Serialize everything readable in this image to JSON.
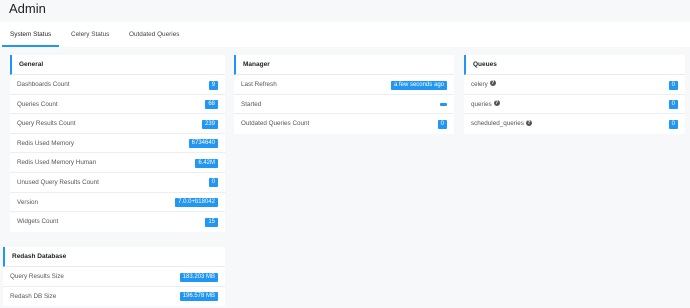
{
  "page": {
    "title": "Admin"
  },
  "tabs": [
    {
      "label": "System Status"
    },
    {
      "label": "Celery Status"
    },
    {
      "label": "Outdated Queries"
    }
  ],
  "general": {
    "title": "General",
    "rows": [
      {
        "label": "Dashboards Count",
        "value": "9"
      },
      {
        "label": "Queries Count",
        "value": "68"
      },
      {
        "label": "Query Results Count",
        "value": "239"
      },
      {
        "label": "Redis Used Memory",
        "value": "6734640"
      },
      {
        "label": "Redis Used Memory Human",
        "value": "6.42M"
      },
      {
        "label": "Unused Query Results Count",
        "value": "0"
      },
      {
        "label": "Version",
        "value": "7.0.0+b18042"
      },
      {
        "label": "Widgets Count",
        "value": "15"
      }
    ]
  },
  "database": {
    "title": "Redash Database",
    "rows": [
      {
        "label": "Query Results Size",
        "value": "183.203 MB"
      },
      {
        "label": "Redash DB Size",
        "value": "196.578 MB"
      }
    ]
  },
  "manager": {
    "title": "Manager",
    "rows": [
      {
        "label": "Last Refresh",
        "value": "a few seconds ago"
      },
      {
        "label": "Started",
        "value": ""
      },
      {
        "label": "Outdated Queries Count",
        "value": "0"
      }
    ]
  },
  "queues": {
    "title": "Queues",
    "rows": [
      {
        "label": "celery",
        "value": "0",
        "icon": "question-circle-icon"
      },
      {
        "label": "queries",
        "value": "0",
        "icon": "question-circle-icon"
      },
      {
        "label": "scheduled_queries",
        "value": "0",
        "icon": "question-circle-icon"
      }
    ]
  },
  "colors": {
    "accent": "#2196f3",
    "background": "#f6f8f9",
    "panel": "#ffffff"
  }
}
